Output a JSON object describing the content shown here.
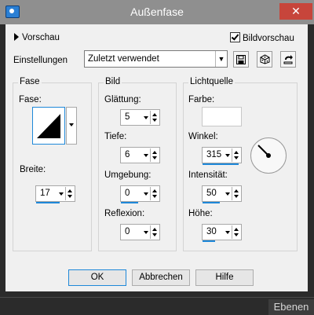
{
  "window": {
    "title": "Außenfase",
    "close_glyph": "✕"
  },
  "top": {
    "preview_label": "Vorschau",
    "preview_checkbox_label": "Bildvorschau",
    "preview_checked": true
  },
  "settings": {
    "label": "Einstellungen",
    "selected": "Zuletzt verwendet",
    "tool_icons": [
      "save-icon",
      "randomize-icon",
      "reset-icon"
    ]
  },
  "bevel": {
    "title": "Fase",
    "bevel_label": "Fase:",
    "width_label": "Breite:",
    "width_value": "17"
  },
  "image": {
    "title": "Bild",
    "smoothness_label": "Glättung:",
    "smoothness_value": "5",
    "depth_label": "Tiefe:",
    "depth_value": "6",
    "ambience_label": "Umgebung:",
    "ambience_value": "0",
    "shininess_label": "Reflexion:",
    "shininess_value": "0"
  },
  "light": {
    "title": "Lichtquelle",
    "color_label": "Farbe:",
    "color": "#ffffff",
    "angle_label": "Winkel:",
    "angle_value": "315",
    "intensity_label": "Intensität:",
    "intensity_value": "50",
    "elevation_label": "Höhe:",
    "elevation_value": "30"
  },
  "buttons": {
    "ok": "OK",
    "cancel": "Abbrechen",
    "help": "Hilfe"
  },
  "statusbar": {
    "tab": "Ebenen"
  },
  "colors": {
    "accent": "#1e88d9",
    "titlebar": "#8f8f8f",
    "close": "#c7453b",
    "dialog_bg": "#f0f0f0"
  }
}
